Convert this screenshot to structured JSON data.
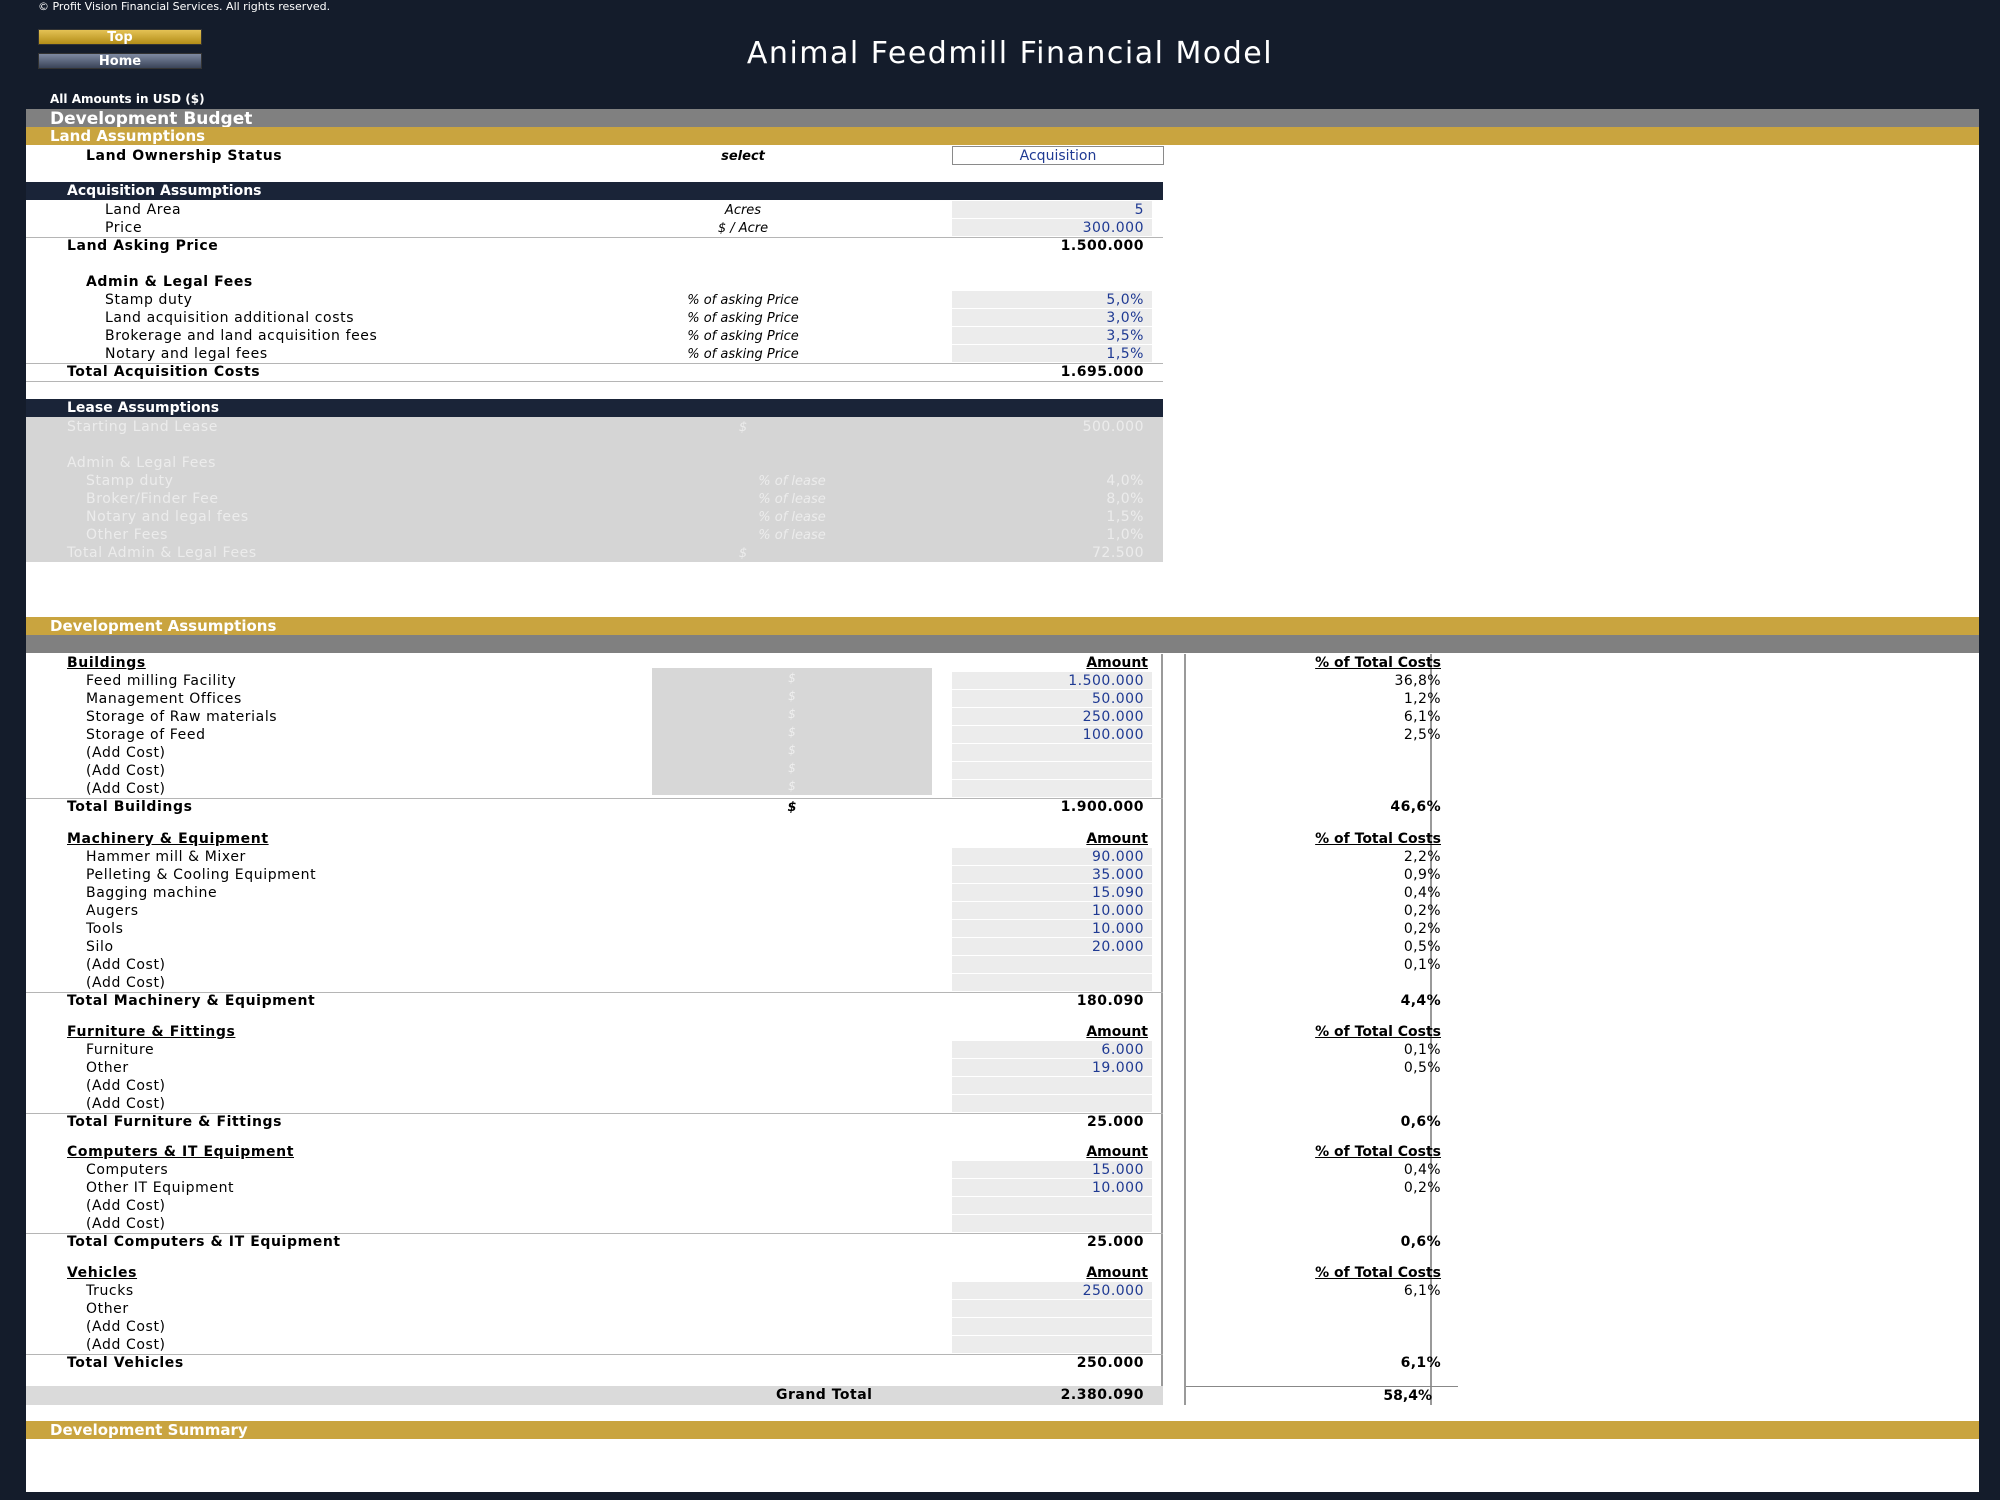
{
  "header": {
    "copyright": "© Profit Vision Financial Services. All rights reserved.",
    "top_button": "Top",
    "home_button": "Home",
    "title": "Animal Feedmill Financial Model",
    "amounts_note": "All Amounts in  USD ($)"
  },
  "sections": {
    "development_budget": "Development Budget",
    "land_assumptions": "Land Assumptions",
    "development_assumptions": "Development Assumptions",
    "development_summary": "Development Summary"
  },
  "land": {
    "ownership_label": "Land Ownership Status",
    "ownership_unit": "select",
    "ownership_value": "Acquisition"
  },
  "acquisition": {
    "header": "Acquisition Assumptions",
    "land_area": {
      "label": "Land Area",
      "unit": "Acres",
      "value": "5"
    },
    "price": {
      "label": "Price",
      "unit": "$ / Acre",
      "value": "300.000"
    },
    "asking_price": {
      "label": "Land Asking Price",
      "value": "1.500.000"
    },
    "admin_label": "Admin & Legal Fees",
    "fees": [
      {
        "label": "Stamp duty",
        "unit": "% of asking Price",
        "value": "5,0%"
      },
      {
        "label": "Land acquisition additional costs",
        "unit": "% of asking Price",
        "value": "3,0%"
      },
      {
        "label": "Brokerage and land acquisition fees",
        "unit": "% of asking Price",
        "value": "3,5%"
      },
      {
        "label": "Notary and legal fees",
        "unit": "% of asking Price",
        "value": "1,5%"
      }
    ],
    "total": {
      "label": "Total Acquisition Costs",
      "value": "1.695.000"
    }
  },
  "lease": {
    "header": "Lease Assumptions",
    "starting": {
      "label": "Starting Land Lease",
      "unit": "$",
      "value": "500.000"
    },
    "admin_label": "Admin & Legal Fees",
    "fees": [
      {
        "label": "Stamp duty",
        "unit": "% of lease",
        "value": "4,0%"
      },
      {
        "label": "Broker/Finder Fee",
        "unit": "% of lease",
        "value": "8,0%"
      },
      {
        "label": "Notary and legal fees",
        "unit": "% of lease",
        "value": "1,5%"
      },
      {
        "label": "Other Fees",
        "unit": "% of lease",
        "value": "1,0%"
      }
    ],
    "total": {
      "label": "Total Admin & Legal Fees",
      "unit": "$",
      "value": "72.500"
    }
  },
  "columns": {
    "amount": "Amount",
    "pct": "% of Total Costs"
  },
  "buildings": {
    "header": "Buildings",
    "unit_symbol": "$",
    "items": [
      {
        "label": "Feed milling Facility",
        "value": "1.500.000",
        "pct": "36,8%"
      },
      {
        "label": "Management Offices",
        "value": "50.000",
        "pct": "1,2%"
      },
      {
        "label": "Storage of Raw materials",
        "value": "250.000",
        "pct": "6,1%"
      },
      {
        "label": "Storage of Feed",
        "value": "100.000",
        "pct": "2,5%"
      },
      {
        "label": "(Add Cost)",
        "value": "",
        "pct": ""
      },
      {
        "label": "(Add Cost)",
        "value": "",
        "pct": ""
      },
      {
        "label": "(Add Cost)",
        "value": "",
        "pct": ""
      }
    ],
    "total": {
      "label": "Total Buildings",
      "unit": "$",
      "value": "1.900.000",
      "pct": "46,6%"
    }
  },
  "machinery": {
    "header": "Machinery & Equipment",
    "items": [
      {
        "label": "Hammer mill & Mixer",
        "value": "90.000",
        "pct": "2,2%"
      },
      {
        "label": "Pelleting & Cooling Equipment",
        "value": "35.000",
        "pct": "0,9%"
      },
      {
        "label": "Bagging machine",
        "value": "15.090",
        "pct": "0,4%"
      },
      {
        "label": "Augers",
        "value": "10.000",
        "pct": "0,2%"
      },
      {
        "label": "Tools",
        "value": "10.000",
        "pct": "0,2%"
      },
      {
        "label": "Silo",
        "value": "20.000",
        "pct": "0,5%"
      },
      {
        "label": "(Add Cost)",
        "value": "",
        "pct": "0,1%"
      },
      {
        "label": "(Add Cost)",
        "value": "",
        "pct": ""
      }
    ],
    "total": {
      "label": "Total Machinery & Equipment",
      "value": "180.090",
      "pct": "4,4%"
    }
  },
  "furniture": {
    "header": "Furniture & Fittings",
    "items": [
      {
        "label": "Furniture",
        "value": "6.000",
        "pct": "0,1%"
      },
      {
        "label": "Other",
        "value": "19.000",
        "pct": "0,5%"
      },
      {
        "label": "(Add Cost)",
        "value": "",
        "pct": ""
      },
      {
        "label": "(Add Cost)",
        "value": "",
        "pct": ""
      }
    ],
    "total": {
      "label": "Total Furniture & Fittings",
      "value": "25.000",
      "pct": "0,6%"
    }
  },
  "computers": {
    "header": "Computers & IT Equipment",
    "items": [
      {
        "label": "Computers",
        "value": "15.000",
        "pct": "0,4%"
      },
      {
        "label": "Other IT Equipment",
        "value": "10.000",
        "pct": "0,2%"
      },
      {
        "label": "(Add Cost)",
        "value": "",
        "pct": ""
      },
      {
        "label": "(Add Cost)",
        "value": "",
        "pct": ""
      }
    ],
    "total": {
      "label": "Total Computers & IT Equipment",
      "value": "25.000",
      "pct": "0,6%"
    }
  },
  "vehicles": {
    "header": "Vehicles",
    "items": [
      {
        "label": "Trucks",
        "value": "250.000",
        "pct": "6,1%"
      },
      {
        "label": "Other",
        "value": "",
        "pct": ""
      },
      {
        "label": "(Add Cost)",
        "value": "",
        "pct": ""
      },
      {
        "label": "(Add Cost)",
        "value": "",
        "pct": ""
      }
    ],
    "total": {
      "label": "Total Vehicles",
      "value": "250.000",
      "pct": "6,1%"
    }
  },
  "grand_total": {
    "label": "Grand Total",
    "value": "2.380.090",
    "pct": "58,4%"
  }
}
